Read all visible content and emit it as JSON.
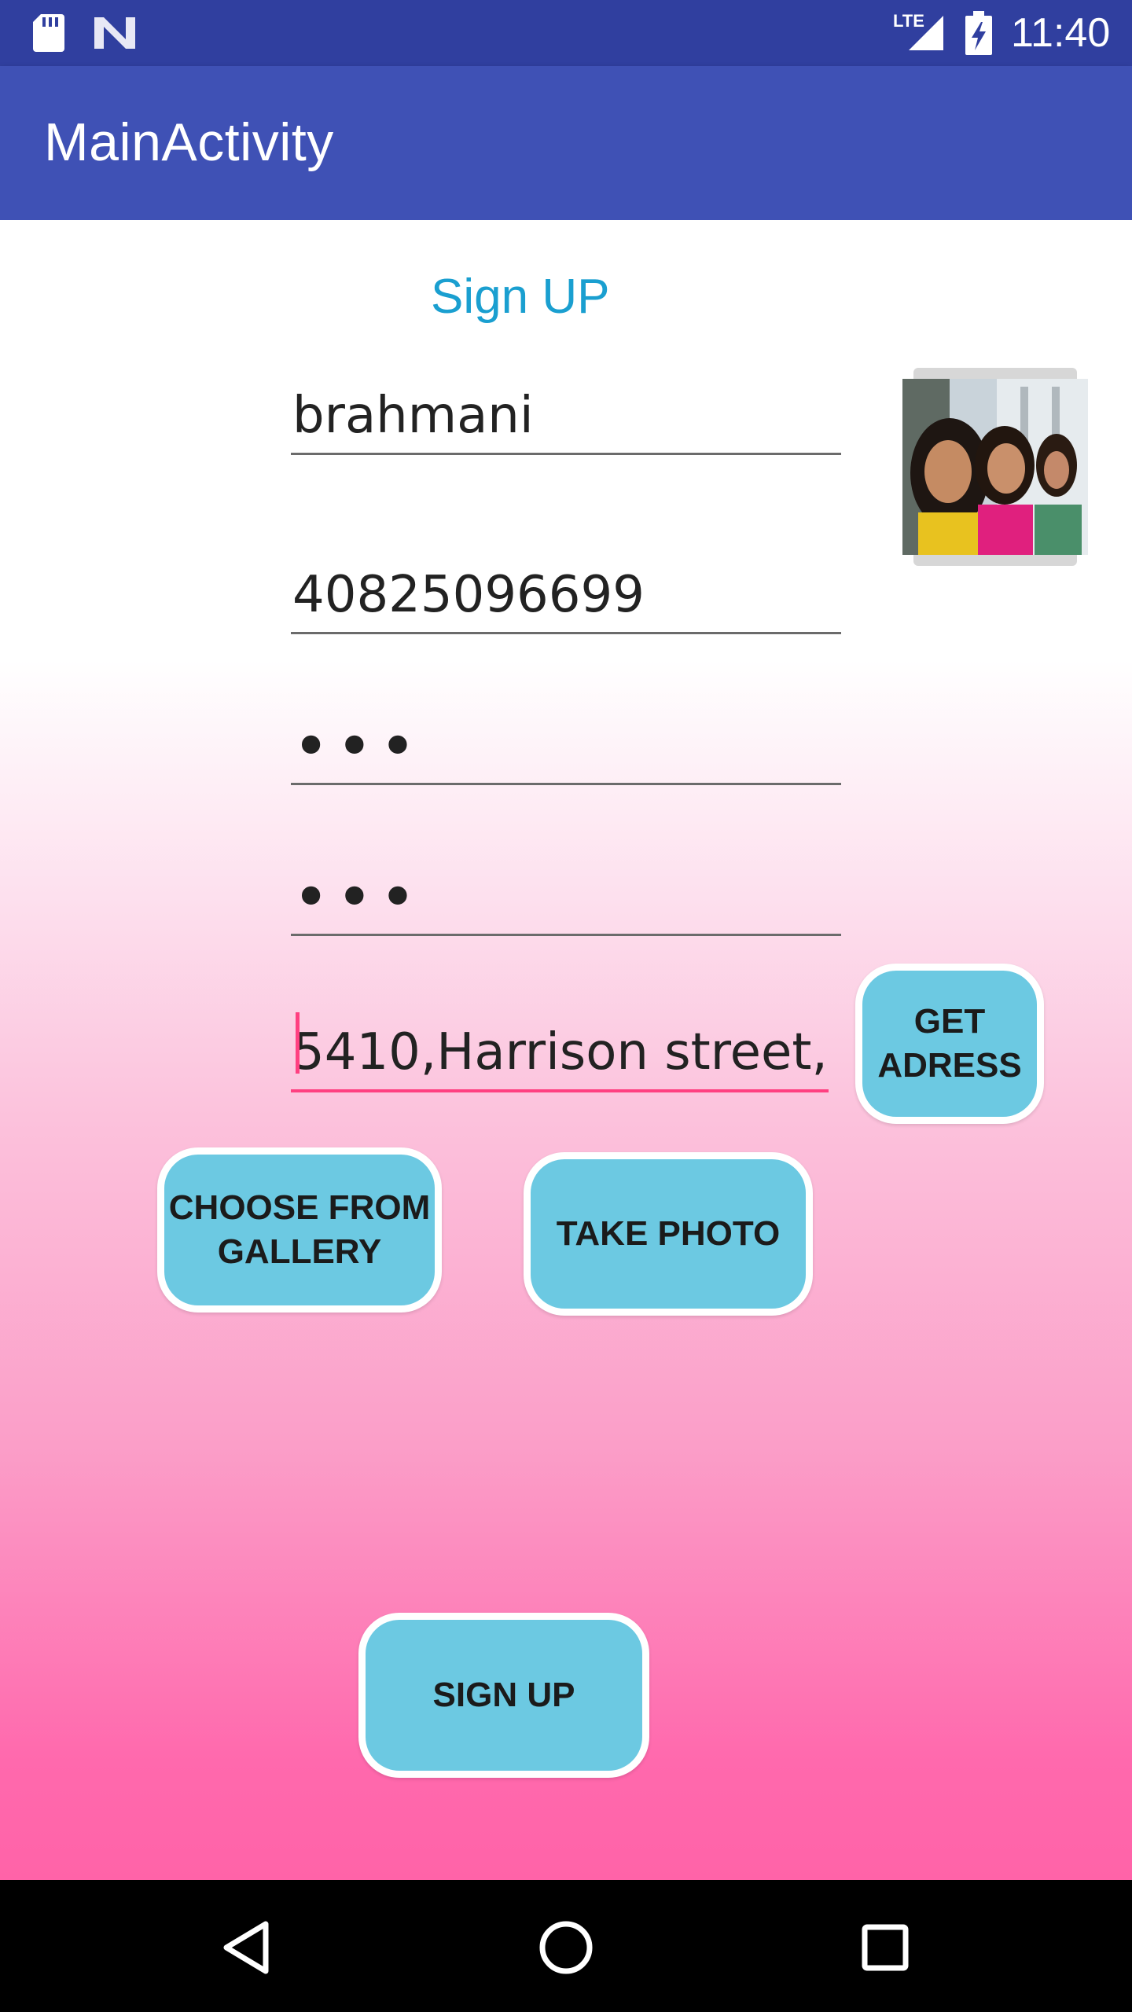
{
  "status_bar": {
    "time": "11:40",
    "network": "LTE",
    "icons": [
      "sd-card-icon",
      "notification-n-icon",
      "lte-signal-icon",
      "battery-charging-icon"
    ]
  },
  "app_bar": {
    "title": "MainActivity"
  },
  "form": {
    "heading": "Sign UP",
    "name_value": "brahmani",
    "phone_value": "40825096699",
    "password_value": "•••",
    "confirm_password_value": "•••",
    "address_value": "5410,Harrison street,"
  },
  "buttons": {
    "get_address_line1": "GET",
    "get_address_line2": "ADRESS",
    "choose_gallery_line1": "CHOOSE FROM",
    "choose_gallery_line2": "GALLERY",
    "take_photo": "TAKE PHOTO",
    "sign_up": "SIGN UP"
  },
  "nav_bar": {
    "icons": [
      "back-icon",
      "home-icon",
      "recents-icon"
    ]
  },
  "colors": {
    "status_bar": "#303f9f",
    "app_bar": "#3f51b5",
    "heading": "#1a9fd0",
    "button_fill": "#6cc9e2",
    "accent": "#ff4081",
    "gradient_bottom": "#ff63a8"
  }
}
